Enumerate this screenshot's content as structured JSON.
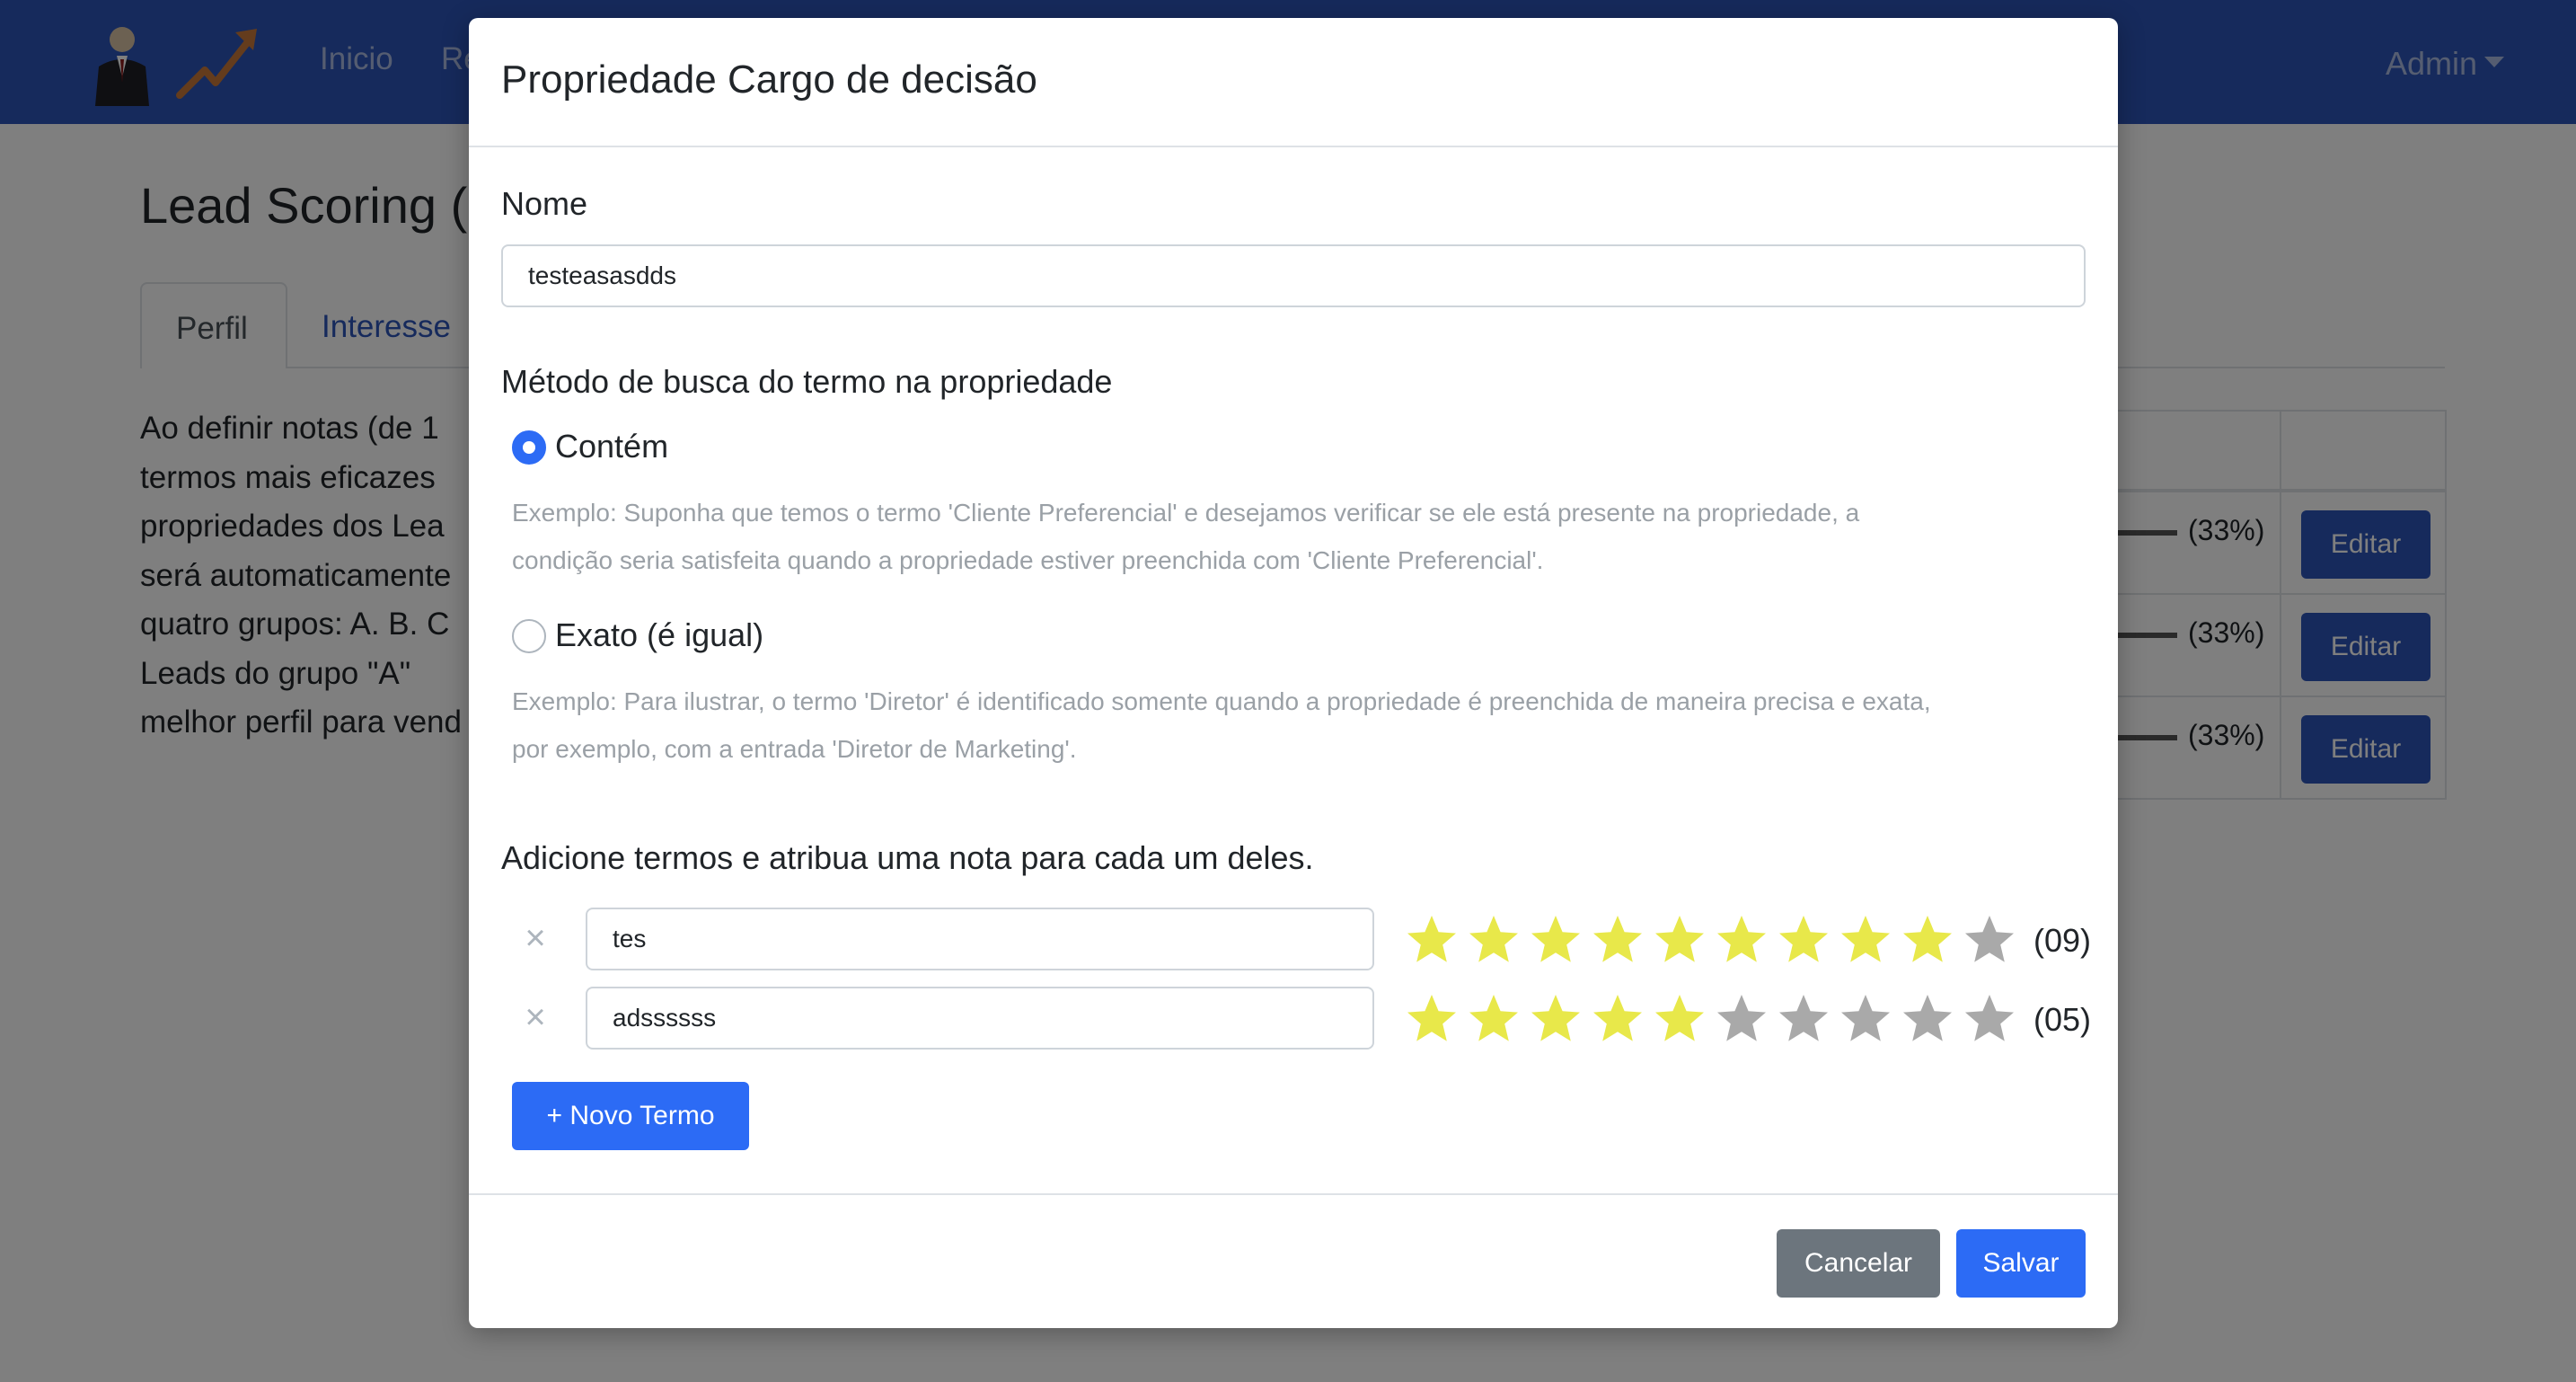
{
  "navbar": {
    "links": [
      "Inicio",
      "Re"
    ],
    "user_menu": "Admin"
  },
  "page": {
    "title": "Lead Scoring (",
    "tabs": [
      "Perfil",
      "Interesse"
    ],
    "intro_lines": [
      "Ao definir notas (de 1",
      "termos mais eficazes",
      "propriedades dos Lea",
      "será automaticamente",
      "quatro grupos: A. B. C",
      "Leads do grupo \"A\"",
      "melhor perfil para vend"
    ],
    "table_rows": [
      {
        "percent_text": "(33%)",
        "percent": 33,
        "action": "Editar"
      },
      {
        "percent_text": "(33%)",
        "percent": 33,
        "action": "Editar"
      },
      {
        "percent_text": "(33%)",
        "percent": 33,
        "action": "Editar"
      }
    ]
  },
  "modal": {
    "title": "Propriedade Cargo de decisão",
    "name_label": "Nome",
    "name_value": "testeasasdds",
    "method_label": "Método de busca do termo na propriedade",
    "options": [
      {
        "label": "Contém",
        "checked": true,
        "help_lines": [
          "Exemplo: Suponha que temos o termo 'Cliente Preferencial' e desejamos verificar se ele está presente na propriedade, a",
          "condição seria satisfeita quando a propriedade estiver preenchida com 'Cliente Preferencial'."
        ]
      },
      {
        "label": "Exato (é igual)",
        "checked": false,
        "help_lines": [
          "Exemplo: Para ilustrar, o termo 'Diretor' é identificado somente quando a propriedade é preenchida de maneira precisa e exata,",
          "por exemplo, com a entrada 'Diretor de Marketing'."
        ]
      }
    ],
    "terms_label": "Adicione termos e atribua uma nota para cada um deles.",
    "terms": [
      {
        "value": "tes",
        "rating": 9,
        "max": 10,
        "score_text": "(09)",
        "remove": "×"
      },
      {
        "value": "adssssss",
        "rating": 5,
        "max": 10,
        "score_text": "(05)",
        "remove": "×"
      }
    ],
    "add_term_button": "+ Novo Termo",
    "cancel_button": "Cancelar",
    "save_button": "Salvar"
  },
  "colors": {
    "navbar": "#2c55b8",
    "primary": "#2c6bf5",
    "secondary": "#6c757d",
    "star_on": "#e8e84a",
    "star_off": "#a9a9a9"
  },
  "icons": {
    "remove": "close-icon",
    "star": "star-icon",
    "caret": "caret-down-icon",
    "logo": "logo-icon"
  }
}
